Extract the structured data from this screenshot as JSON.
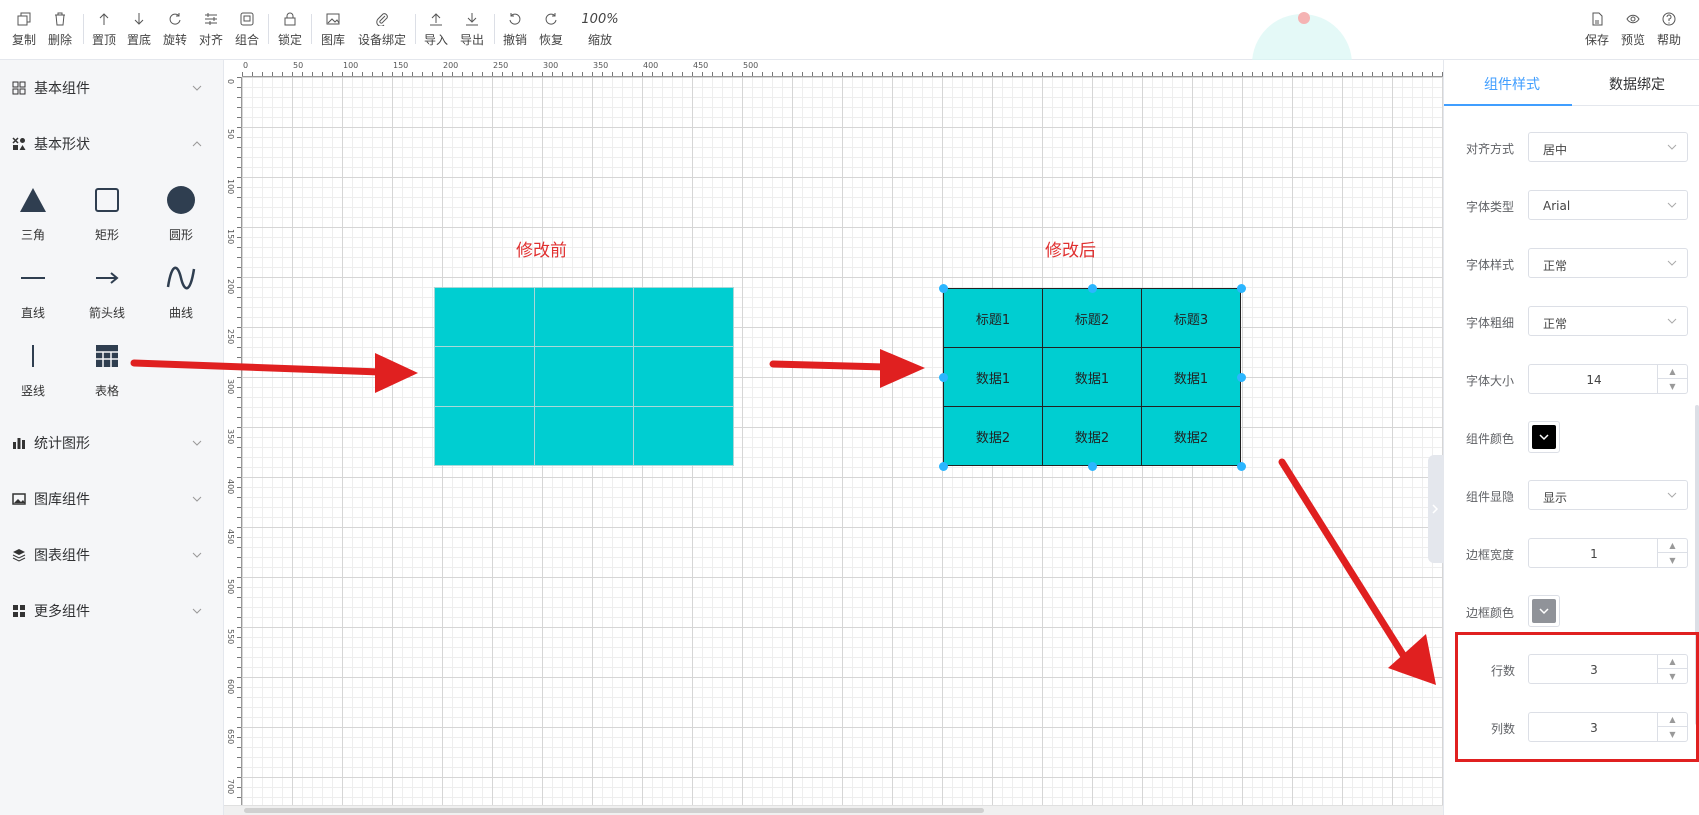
{
  "toolbar": {
    "left": [
      {
        "label": "复制",
        "icon": "copy-icon"
      },
      {
        "label": "删除",
        "icon": "trash-icon"
      },
      {
        "label": "置顶",
        "icon": "arrow-up-icon"
      },
      {
        "label": "置底",
        "icon": "arrow-down-icon"
      },
      {
        "label": "旋转",
        "icon": "rotate-icon"
      },
      {
        "label": "对齐",
        "icon": "align-icon"
      },
      {
        "label": "组合",
        "icon": "group-icon"
      },
      {
        "label": "锁定",
        "icon": "lock-icon"
      },
      {
        "label": "图库",
        "icon": "image-icon"
      },
      {
        "label": "设备绑定",
        "icon": "paperclip-icon"
      },
      {
        "label": "导入",
        "icon": "import-icon"
      },
      {
        "label": "导出",
        "icon": "export-icon"
      },
      {
        "label": "撤销",
        "icon": "undo-icon"
      },
      {
        "label": "恢复",
        "icon": "redo-icon"
      }
    ],
    "zoom": {
      "value": "100%",
      "label": "缩放"
    },
    "right": [
      {
        "label": "保存",
        "icon": "save-icon"
      },
      {
        "label": "预览",
        "icon": "eye-icon"
      },
      {
        "label": "帮助",
        "icon": "help-icon"
      }
    ]
  },
  "sidebar": {
    "sections": [
      {
        "label": "基本组件",
        "icon": "grid-icon",
        "expanded": false
      },
      {
        "label": "基本形状",
        "icon": "shapes-icon",
        "expanded": true
      },
      {
        "label": "统计图形",
        "icon": "bar-chart-icon",
        "expanded": false
      },
      {
        "label": "图库组件",
        "icon": "picture-icon",
        "expanded": false
      },
      {
        "label": "图表组件",
        "icon": "layers-icon",
        "expanded": false
      },
      {
        "label": "更多组件",
        "icon": "apps-icon",
        "expanded": false
      }
    ],
    "shapes": [
      {
        "label": "三角",
        "icon": "triangle-icon"
      },
      {
        "label": "矩形",
        "icon": "rectangle-icon"
      },
      {
        "label": "圆形",
        "icon": "circle-icon"
      },
      {
        "label": "直线",
        "icon": "line-icon"
      },
      {
        "label": "箭头线",
        "icon": "arrow-line-icon"
      },
      {
        "label": "曲线",
        "icon": "curve-icon"
      },
      {
        "label": "竖线",
        "icon": "vertical-line-icon"
      },
      {
        "label": "表格",
        "icon": "table-icon"
      }
    ]
  },
  "canvas": {
    "ruler_h": [
      "0",
      "50",
      "100",
      "150",
      "200",
      "250",
      "300",
      "350",
      "400",
      "450",
      "500"
    ],
    "ruler_v": [
      "0",
      "50",
      "100",
      "150",
      "200",
      "250",
      "300",
      "350",
      "400",
      "450",
      "500",
      "550",
      "600",
      "650",
      "700"
    ],
    "before_label": "修改前",
    "after_label": "修改后",
    "after_table": [
      [
        "标题1",
        "标题2",
        "标题3"
      ],
      [
        "数据1",
        "数据1",
        "数据1"
      ],
      [
        "数据2",
        "数据2",
        "数据2"
      ]
    ]
  },
  "right_panel": {
    "tabs": [
      "组件样式",
      "数据绑定"
    ],
    "active_tab": 0,
    "fields": {
      "align": {
        "label": "对齐方式",
        "value": "居中"
      },
      "font_family": {
        "label": "字体类型",
        "value": "Arial"
      },
      "font_style": {
        "label": "字体样式",
        "value": "正常"
      },
      "font_weight": {
        "label": "字体粗细",
        "value": "正常"
      },
      "font_size": {
        "label": "字体大小",
        "value": "14"
      },
      "comp_color": {
        "label": "组件颜色",
        "value": "#000000"
      },
      "visibility": {
        "label": "组件显隐",
        "value": "显示"
      },
      "border_width": {
        "label": "边框宽度",
        "value": "1"
      },
      "border_color": {
        "label": "边框颜色",
        "value": "#909399"
      },
      "rows": {
        "label": "行数",
        "value": "3"
      },
      "cols": {
        "label": "列数",
        "value": "3"
      }
    }
  },
  "colors": {
    "accent": "#409eff",
    "table_fill": "#00ced1",
    "annotation_red": "#e02020"
  }
}
